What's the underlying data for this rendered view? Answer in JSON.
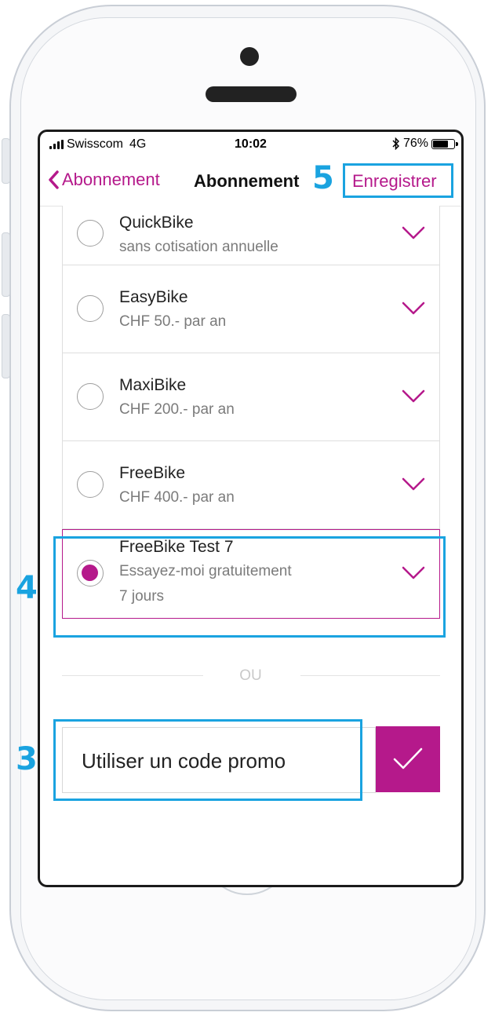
{
  "status_bar": {
    "carrier": "Swisscom",
    "network": "4G",
    "time": "10:02",
    "bluetooth_icon": "bluetooth-icon",
    "battery": "76%",
    "battery_level": 0.76
  },
  "nav": {
    "back_label": "Abonnement",
    "title": "Abonnement",
    "save_label": "Enregistrer"
  },
  "plans": [
    {
      "name": "QuickBike",
      "sub": "sans cotisation annuelle",
      "selected": false
    },
    {
      "name": "EasyBike",
      "sub": "CHF 50.- par an",
      "selected": false
    },
    {
      "name": "MaxiBike",
      "sub": "CHF 200.- par an",
      "selected": false
    },
    {
      "name": "FreeBike",
      "sub": "CHF 400.- par an",
      "selected": false
    },
    {
      "name": "FreeBike Test 7",
      "sub": "Essayez-moi gratuitement",
      "extra": "7 jours",
      "selected": true
    }
  ],
  "separator_text": "OU",
  "promo": {
    "placeholder": "Utiliser un code promo",
    "submit_icon": "checkmark-icon"
  },
  "annotations": {
    "n3": "3",
    "n4": "4",
    "n5": "5"
  },
  "colors": {
    "accent": "#b5198b",
    "annotation": "#1aa3e0"
  }
}
